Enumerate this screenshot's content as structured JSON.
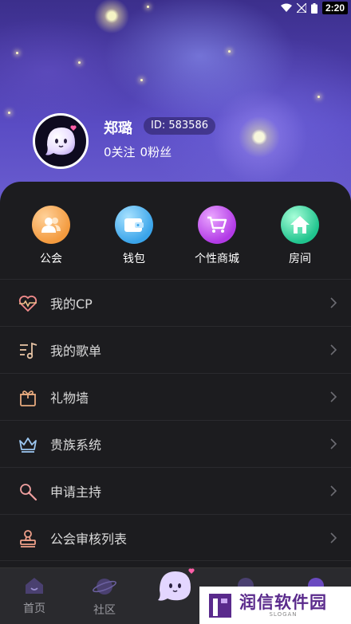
{
  "status_bar": {
    "time": "2:20"
  },
  "profile": {
    "name": "郑璐",
    "id_text": "ID: 583586",
    "following": "0关注",
    "fans": "0粉丝"
  },
  "quick_actions": [
    {
      "label": "公会",
      "icon": "guild-icon",
      "color": "#f5a24a"
    },
    {
      "label": "钱包",
      "icon": "wallet-icon",
      "color": "#4fb6f2"
    },
    {
      "label": "个性商城",
      "icon": "cart-icon",
      "color": "#c24cf0"
    },
    {
      "label": "房间",
      "icon": "home-icon",
      "color": "#34d3a0"
    }
  ],
  "menu": [
    {
      "label": "我的CP",
      "icon": "heartbeat-icon"
    },
    {
      "label": "我的歌单",
      "icon": "music-list-icon"
    },
    {
      "label": "礼物墙",
      "icon": "gift-icon"
    },
    {
      "label": "贵族系统",
      "icon": "crown-icon"
    },
    {
      "label": "申请主持",
      "icon": "microphone-icon"
    },
    {
      "label": "公会审核列表",
      "icon": "stamp-icon"
    }
  ],
  "bottom_nav": [
    {
      "label": "首页",
      "icon": "home-nav-icon"
    },
    {
      "label": "社区",
      "icon": "planet-icon"
    }
  ],
  "watermark": {
    "text": "润信软件园",
    "sub": "SLOGAN"
  }
}
